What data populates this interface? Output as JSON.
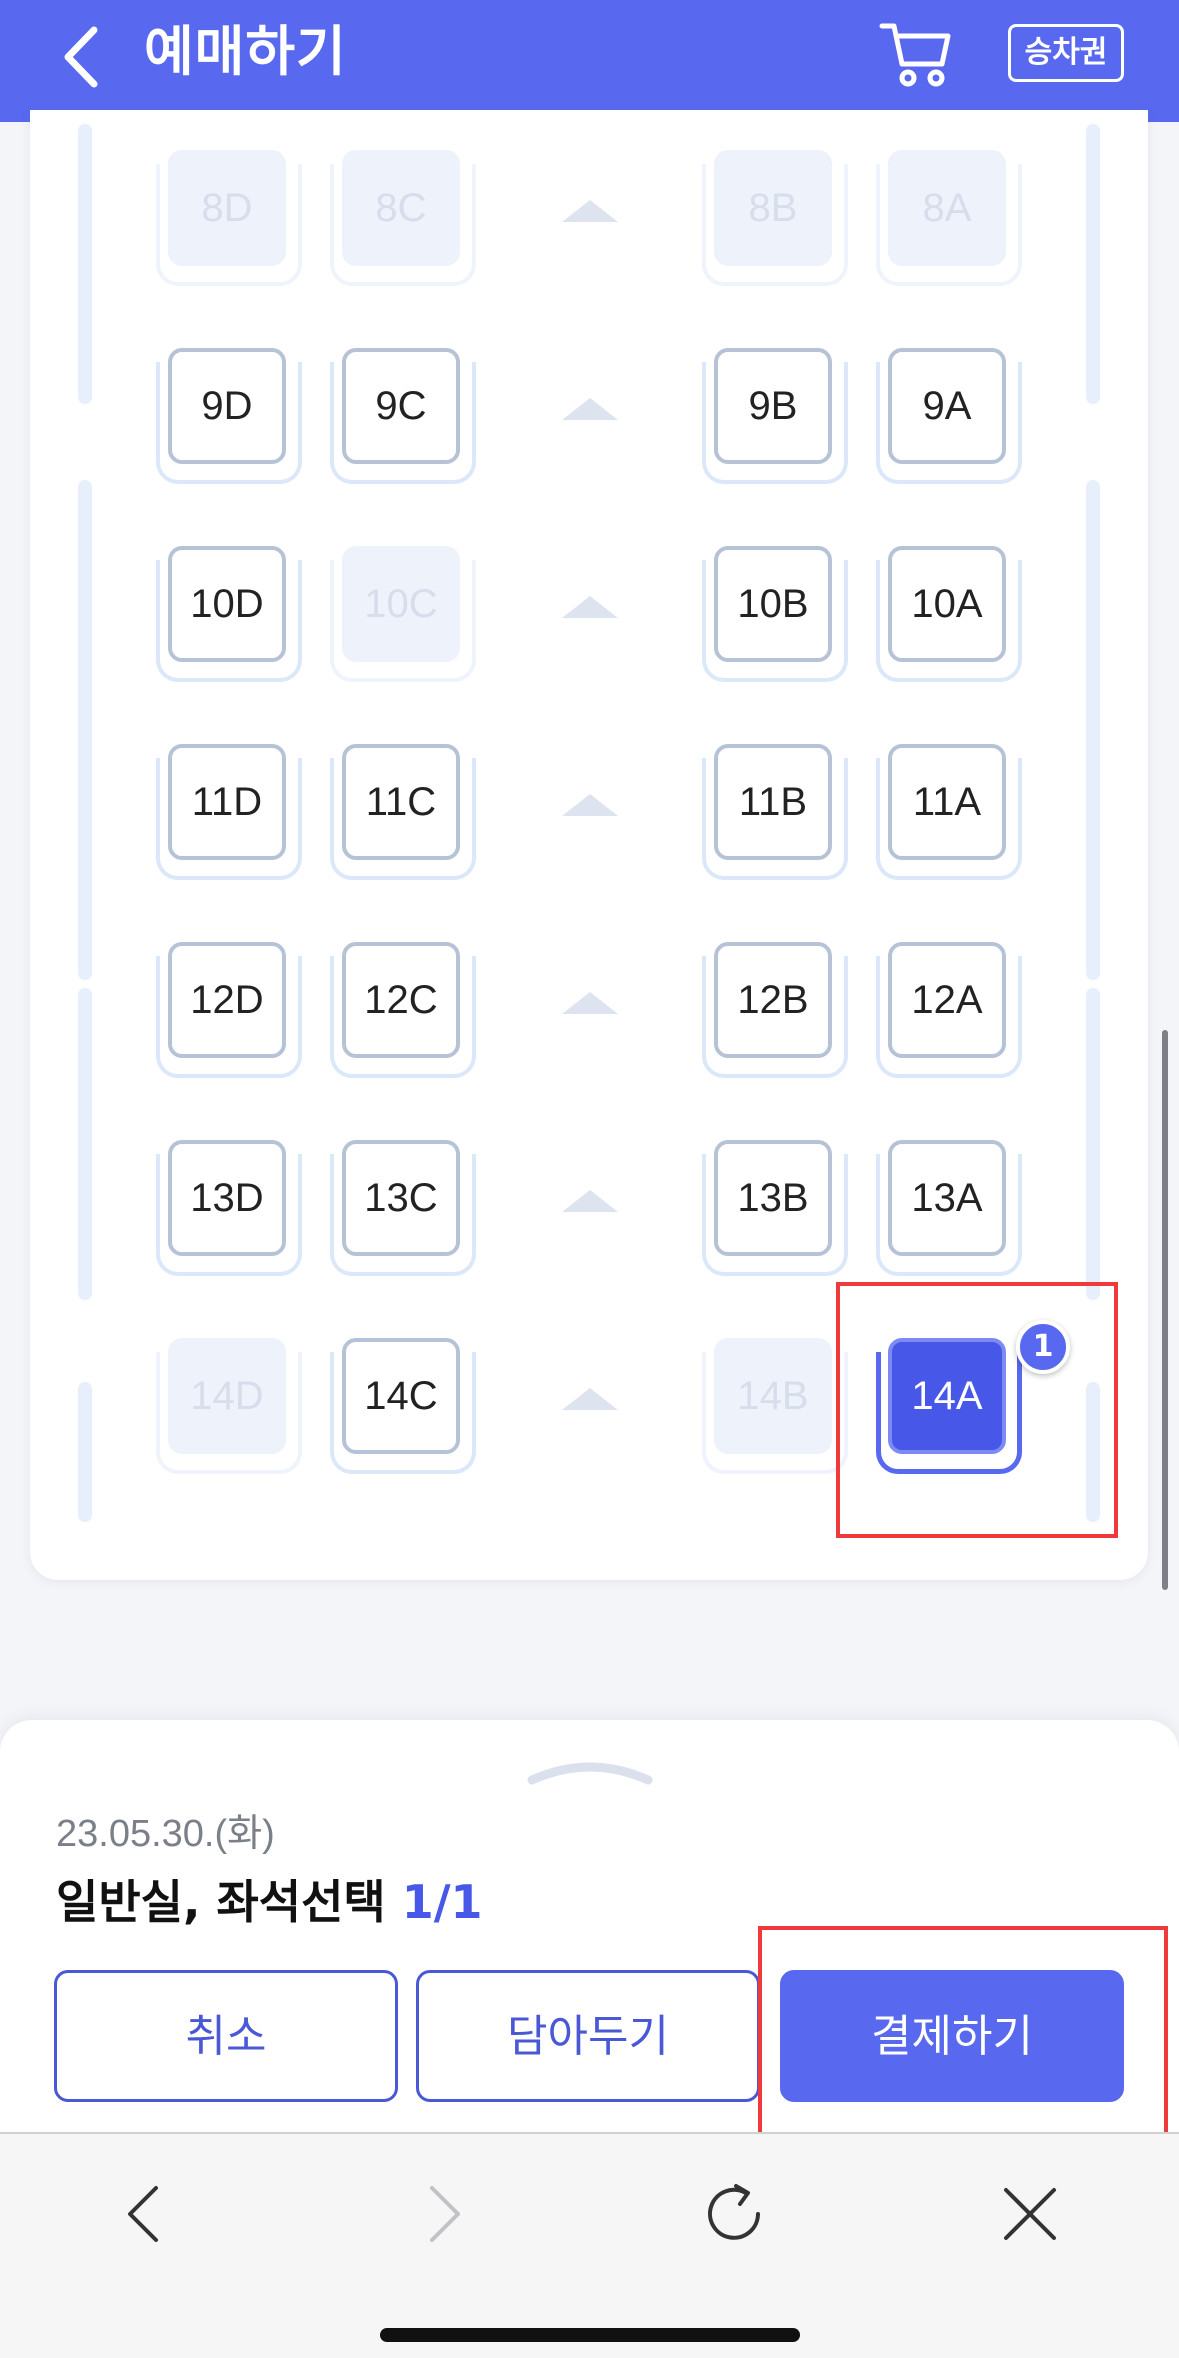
{
  "header": {
    "title": "예매하기",
    "ticket_label": "승차권",
    "back_icon": "chevron-left-icon",
    "cart_icon": "cart-icon"
  },
  "seats": {
    "8D": "8D",
    "8C": "8C",
    "8B": "8B",
    "8A": "8A",
    "9D": "9D",
    "9C": "9C",
    "9B": "9B",
    "9A": "9A",
    "10D": "10D",
    "10C": "10C",
    "10B": "10B",
    "10A": "10A",
    "11D": "11D",
    "11C": "11C",
    "11B": "11B",
    "11A": "11A",
    "12D": "12D",
    "12C": "12C",
    "12B": "12B",
    "12A": "12A",
    "13D": "13D",
    "13C": "13C",
    "13B": "13B",
    "13A": "13A",
    "14D": "14D",
    "14C": "14C",
    "14B": "14B",
    "14A": "14A"
  },
  "selected_badge": "1",
  "sheet": {
    "date": "23.05.30.(화)",
    "class_label": "일반실, 좌석선택",
    "count": "1/1",
    "cancel_label": "취소",
    "save_label": "담아두기",
    "pay_label": "결제하기"
  },
  "colors": {
    "brand": "#5868ef",
    "selected_seat": "#4757e8",
    "annotation_red": "#f0393a"
  }
}
